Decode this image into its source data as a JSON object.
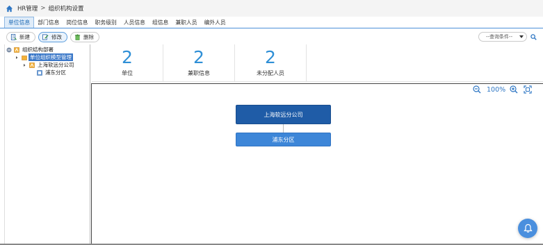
{
  "breadcrumb": {
    "root": "HR管理",
    "separator": ">",
    "current": "组织机构设置"
  },
  "tabs": [
    {
      "label": "单位信息",
      "active": true
    },
    {
      "label": "部门信息",
      "active": false
    },
    {
      "label": "岗位信息",
      "active": false
    },
    {
      "label": "职务级别",
      "active": false
    },
    {
      "label": "人员信息",
      "active": false
    },
    {
      "label": "组信息",
      "active": false
    },
    {
      "label": "兼职人员",
      "active": false
    },
    {
      "label": "编外人员",
      "active": false
    }
  ],
  "toolbar": {
    "new_label": "新建",
    "edit_label": "修改",
    "delete_label": "删除",
    "query_placeholder": "--查询条件--"
  },
  "tree": {
    "root": "组织结构部署",
    "selected": "单位组织模型管理",
    "company": "上海软远分公司",
    "branch": "浦东分区"
  },
  "stats": [
    {
      "value": "2",
      "label": "单位"
    },
    {
      "value": "2",
      "label": "兼职信息"
    },
    {
      "value": "2",
      "label": "未分配人员"
    }
  ],
  "canvas": {
    "zoom": "100%",
    "root_node": "上海软远分公司",
    "child_node": "浦东分区"
  },
  "colors": {
    "accent": "#2f8fd6",
    "root_node": "#1f5ca7",
    "child_node": "#3d86d8",
    "tree_selected": "#3b78c8"
  }
}
